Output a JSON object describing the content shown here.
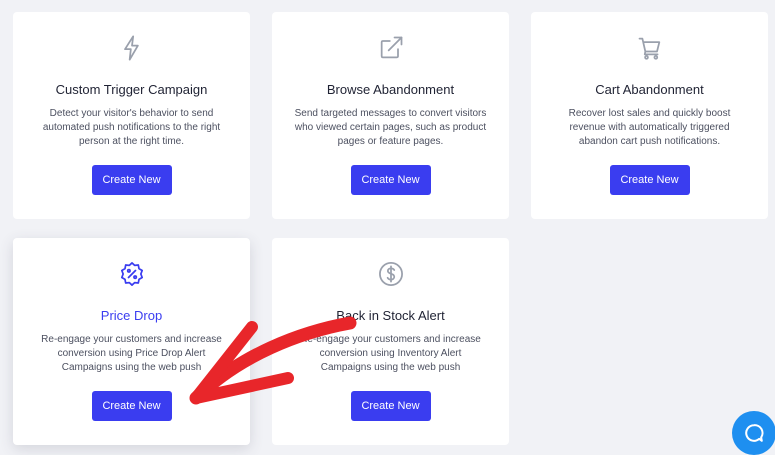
{
  "cards": [
    {
      "title": "Custom Trigger Campaign",
      "description": "Detect your visitor's behavior to send automated push notifications to the right person at the right time.",
      "button": "Create New",
      "icon": "lightning-icon"
    },
    {
      "title": "Browse Abandonment",
      "description": "Send targeted messages to convert visitors who viewed certain pages, such as product pages or feature pages.",
      "button": "Create New",
      "icon": "external-link-icon"
    },
    {
      "title": "Cart Abandonment",
      "description": "Recover lost sales and quickly boost revenue with automatically triggered abandon cart push notifications.",
      "button": "Create New",
      "icon": "cart-icon"
    },
    {
      "title": "Price Drop",
      "description": "Re-engage your customers and increase conversion using Price Drop Alert Campaigns using the web push",
      "button": "Create New",
      "icon": "discount-badge-icon"
    },
    {
      "title": "Back in Stock Alert",
      "description": "Re-engage your customers and increase conversion using Inventory Alert Campaigns using the web push",
      "button": "Create New",
      "icon": "dollar-circle-icon"
    }
  ],
  "colors": {
    "accent": "#3a3df0",
    "annotation_arrow": "#e8262a",
    "chat_widget": "#1e8ff0"
  },
  "chat_widget": {
    "icon": "chat-icon"
  }
}
